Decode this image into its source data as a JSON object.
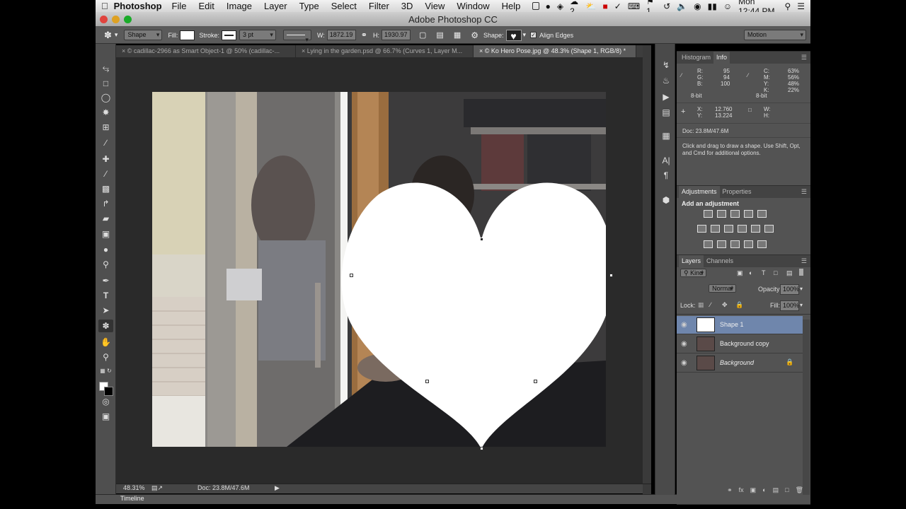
{
  "menubar": {
    "app_name": "Photoshop",
    "items": [
      "File",
      "Edit",
      "Image",
      "Layer",
      "Type",
      "Select",
      "Filter",
      "3D",
      "View",
      "Window",
      "Help"
    ],
    "clock": "Mon 12:44 PM",
    "badge_count": "2",
    "flag_count": "1"
  },
  "window": {
    "title": "Adobe Photoshop CC"
  },
  "options_bar": {
    "mode": "Shape",
    "fill_label": "Fill:",
    "stroke_label": "Stroke:",
    "stroke_width": "3 pt",
    "w_label": "W:",
    "width_value": "1872.19",
    "h_label": "H:",
    "height_value": "1930.97",
    "shape_label": "Shape:",
    "align_edges": "Align Edges",
    "workspace": "Motion"
  },
  "tabs": [
    {
      "label": "© cadillac-2966 as Smart Object-1 @ 50% (cadillac-...",
      "active": false
    },
    {
      "label": "Lying in the garden.psd @ 66.7% (Curves 1, Layer M...",
      "active": false
    },
    {
      "label": "© Ko Hero Pose.jpg @ 48.3% (Shape 1, RGB/8) *",
      "active": true
    }
  ],
  "info_panel": {
    "tabs": [
      "Histogram",
      "Info"
    ],
    "r": "R:",
    "r_val": "95",
    "g": "G:",
    "g_val": "94",
    "b": "B:",
    "b_val": "100",
    "bit1": "8-bit",
    "c": "C:",
    "c_val": "63%",
    "m": "M:",
    "m_val": "56%",
    "y": "Y:",
    "y_val": "48%",
    "k": "K:",
    "k_val": "22%",
    "bit2": "8-bit",
    "x": "X:",
    "x_val": "12.760",
    "yy": "Y:",
    "yy_val": "13.224",
    "w": "W:",
    "h": "H:",
    "doc": "Doc: 23.8M/47.6M",
    "hint": "Click and drag to draw a shape.  Use Shift, Opt, and Cmd for additional options."
  },
  "adjustments_panel": {
    "tabs": [
      "Adjustments",
      "Properties"
    ],
    "title": "Add an adjustment"
  },
  "layers_panel": {
    "tabs": [
      "Layers",
      "Channels"
    ],
    "filter": "Kind",
    "blend": "Normal",
    "opacity_label": "Opacity:",
    "opacity": "100%",
    "lock_label": "Lock:",
    "fill_label": "Fill:",
    "fill": "100%",
    "layers": [
      {
        "name": "Shape 1",
        "selected": true
      },
      {
        "name": "Background copy",
        "selected": false
      },
      {
        "name": "Background",
        "selected": false
      }
    ]
  },
  "status_bar": {
    "zoom": "48.31%",
    "doc": "Doc: 23.8M/47.6M"
  },
  "timeline": {
    "label": "Timeline"
  },
  "colors": {
    "accent": "#6f86ac",
    "panel": "#535353",
    "canvas_bg": "#2a2a2a"
  }
}
